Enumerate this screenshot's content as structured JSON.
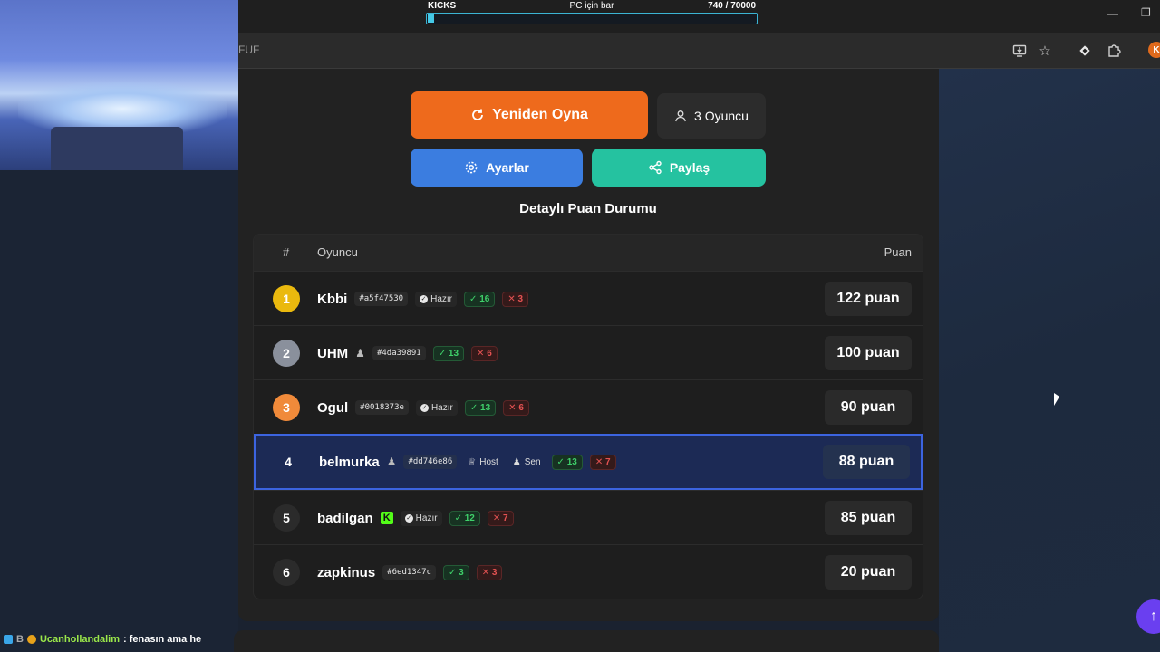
{
  "stream_overlay": {
    "kicks_label": "KICKS",
    "goal_title": "PC için bar",
    "goal_progress": "740  / 70000",
    "goal_fraction": 0.0106
  },
  "browser": {
    "url_fragment": "FUF",
    "profile_initial": "K",
    "icons": [
      "install-icon",
      "star-icon",
      "extension-icon",
      "puzzle-icon"
    ]
  },
  "actions": {
    "replay_label": "Yeniden Oyna",
    "players_label": "3 Oyuncu",
    "settings_label": "Ayarlar",
    "share_label": "Paylaş"
  },
  "scoreboard": {
    "title": "Detaylı Puan Durumu",
    "headers": {
      "num": "#",
      "player": "Oyuncu",
      "score": "Puan"
    },
    "rows": [
      {
        "rank": "1",
        "name": "Kbbi",
        "tag": "#a5f47530",
        "ready": "Hazır",
        "correct": "16",
        "wrong": "3",
        "score": "122 puan"
      },
      {
        "rank": "2",
        "name": "UHM",
        "tag": "#4da39891",
        "correct": "13",
        "wrong": "6",
        "score": "100 puan"
      },
      {
        "rank": "3",
        "name": "Ogul",
        "tag": "#0018373e",
        "ready": "Hazır",
        "correct": "13",
        "wrong": "6",
        "score": "90 puan"
      },
      {
        "rank": "4",
        "name": "belmurka",
        "tag": "#dd746e86",
        "host": "Host",
        "you": "Sen",
        "correct": "13",
        "wrong": "7",
        "score": "88 puan"
      },
      {
        "rank": "5",
        "name": "badilgan",
        "ready": "Hazır",
        "correct": "12",
        "wrong": "7",
        "score": "85 puan"
      },
      {
        "rank": "6",
        "name": "zapkinus",
        "tag": "#6ed1347c",
        "correct": "3",
        "wrong": "3",
        "score": "20 puan"
      }
    ]
  },
  "chat": {
    "badge_letter": "B",
    "username": "Ucanhollandalim",
    "message": ": fenasın ama he"
  },
  "colors": {
    "replay": "#ee6a1c",
    "settings": "#3b7de0",
    "share": "#25c2a0",
    "highlight_border": "#3c64e0"
  }
}
